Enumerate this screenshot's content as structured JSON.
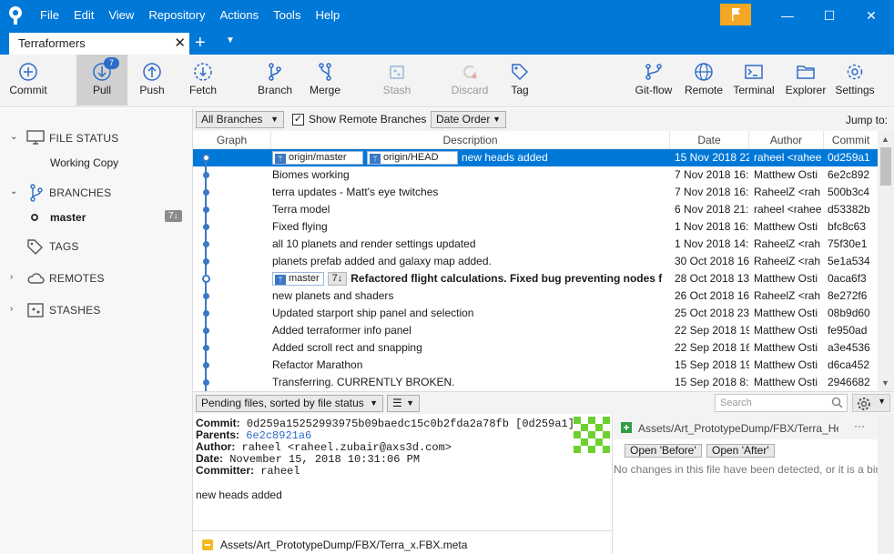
{
  "menu": [
    "File",
    "Edit",
    "View",
    "Repository",
    "Actions",
    "Tools",
    "Help"
  ],
  "window": {
    "minimize": "—",
    "maximize": "☐",
    "close": "✕"
  },
  "tab": {
    "title": "Terraformers",
    "close": "✕",
    "add": "+"
  },
  "toolbar": {
    "commit": "Commit",
    "pull": "Pull",
    "pull_badge": "7",
    "push": "Push",
    "fetch": "Fetch",
    "branch": "Branch",
    "merge": "Merge",
    "stash": "Stash",
    "discard": "Discard",
    "tag": "Tag",
    "gitflow": "Git-flow",
    "remote": "Remote",
    "terminal": "Terminal",
    "explorer": "Explorer",
    "settings": "Settings"
  },
  "sidebar": {
    "file_status": "FILE STATUS",
    "working_copy": "Working Copy",
    "branches": "BRANCHES",
    "branch_master": "master",
    "branch_master_badge": "7↓",
    "tags": "TAGS",
    "remotes": "REMOTES",
    "stashes": "STASHES"
  },
  "filterbar": {
    "branches_combo": "All Branches",
    "show_remote": "Show Remote Branches",
    "show_remote_checked": true,
    "order_combo": "Date Order",
    "jump_to": "Jump to:"
  },
  "columns": {
    "graph": "Graph",
    "description": "Description",
    "date": "Date",
    "author": "Author",
    "commit": "Commit"
  },
  "commits": [
    {
      "refs": [
        "origin/master",
        "origin/HEAD"
      ],
      "desc": "new heads added",
      "date": "15 Nov 2018 22",
      "author": "raheel <rahee",
      "hash": "0d259a1",
      "selected": true,
      "ring": true
    },
    {
      "desc": "Biomes working",
      "date": "7 Nov 2018 16:",
      "author": "Matthew Osti",
      "hash": "6e2c892"
    },
    {
      "desc": "terra updates - Matt's eye twitches",
      "date": "7 Nov 2018 16:",
      "author": "RaheelZ <rah",
      "hash": "500b3c4"
    },
    {
      "desc": "Terra model",
      "date": "6 Nov 2018 21:",
      "author": "raheel <rahee",
      "hash": "d53382b"
    },
    {
      "desc": "Fixed flying",
      "date": "1 Nov 2018 16:",
      "author": "Matthew Osti",
      "hash": "bfc8c63"
    },
    {
      "desc": "all 10 planets and render settings updated",
      "date": "1 Nov 2018 14:",
      "author": "RaheelZ <rah",
      "hash": "75f30e1"
    },
    {
      "desc": "planets prefab added and galaxy map added.",
      "date": "30 Oct 2018 16",
      "author": "RaheelZ <rah",
      "hash": "5e1a534"
    },
    {
      "branch": "master",
      "count": "7↓",
      "desc": "Refactored flight calculations. Fixed bug preventing nodes f",
      "date": "28 Oct 2018 13",
      "author": "Matthew Osti",
      "hash": "0aca6f3",
      "bold": true,
      "ring": true
    },
    {
      "desc": "new planets and shaders",
      "date": "26 Oct 2018 16",
      "author": "RaheelZ <rah",
      "hash": "8e272f6"
    },
    {
      "desc": "Updated starport ship panel and selection",
      "date": "25 Oct 2018 23",
      "author": "Matthew Osti",
      "hash": "08b9d60"
    },
    {
      "desc": "Added terraformer info panel",
      "date": "22 Sep 2018 19",
      "author": "Matthew Osti",
      "hash": "fe950ad"
    },
    {
      "desc": "Added scroll rect and snapping",
      "date": "22 Sep 2018 16",
      "author": "Matthew Osti",
      "hash": "a3e4536"
    },
    {
      "desc": "Refactor Marathon",
      "date": "15 Sep 2018 19",
      "author": "Matthew Osti",
      "hash": "d6ca452"
    },
    {
      "desc": "Transferring. CURRENTLY BROKEN.",
      "date": "15 Sep 2018 8:",
      "author": "Matthew Osti",
      "hash": "2946682"
    }
  ],
  "lower": {
    "pending_combo": "Pending files, sorted by file status",
    "search_placeholder": "Search"
  },
  "details": {
    "commit_label": "Commit:",
    "commit_value": "0d259a15252993975b09baedc15c0b2fda2a78fb [0d259a1]",
    "parents_label": "Parents:",
    "parents_value": "6e2c8921a6",
    "author_label": "Author:",
    "author_value": "raheel <raheel.zubair@axs3d.com>",
    "date_label": "Date:",
    "date_value": "November 15, 2018 10:31:06 PM",
    "committer_label": "Committer:",
    "committer_value": "raheel",
    "message": "new heads added",
    "file": "Assets/Art_PrototypeDump/FBX/Terra_x.FBX.meta"
  },
  "diff": {
    "path": "Assets/Art_PrototypeDump/FBX/Terra_Hea",
    "more": "···",
    "open_before": "Open 'Before'",
    "open_after": "Open 'After'",
    "message": "No changes in this file have been detected, or it is a binar"
  },
  "colors": {
    "accent": "#0078d7",
    "graph": "#3b78c4",
    "flag": "#f5a623",
    "add_icon": "#2f9e44",
    "badge": "#2b6cc8"
  }
}
